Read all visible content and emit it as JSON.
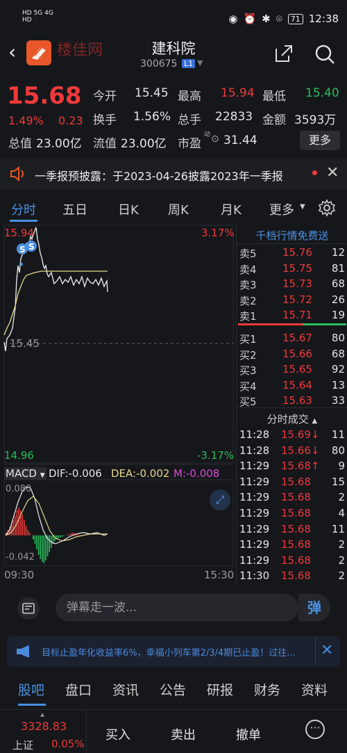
{
  "status_bar": {
    "left_top": "HD 5G 4G",
    "left_bottom": "HD",
    "battery": "71",
    "time": "12:38"
  },
  "header": {
    "watermark": "楼佳网",
    "name": "建科院",
    "code": "300675",
    "level": "L1"
  },
  "quote": {
    "price": "15.68",
    "change_pct": "1.49%",
    "change": "0.23",
    "open_label": "今开",
    "open": "15.45",
    "high_label": "最高",
    "high": "15.94",
    "low_label": "最低",
    "low": "15.40",
    "turnover_label": "换手",
    "turnover": "1.56%",
    "volume_label": "总手",
    "volume": "22833",
    "amount_label": "金额",
    "amount": "3593万",
    "total_cap_label": "总值",
    "total_cap": "23.00亿",
    "float_cap_label": "流值",
    "float_cap": "23.00亿",
    "pe_label": "市盈",
    "pe_sup": "动",
    "pe": "31.44",
    "more_label": "更多"
  },
  "news": {
    "text": "一季报预披露：于2023-04-26披露2023年一季报"
  },
  "chart_tabs": [
    "分时",
    "五日",
    "日K",
    "周K",
    "月K",
    "更多"
  ],
  "chart": {
    "y_top": "15.94",
    "y_bottom": "14.96",
    "pct_top": "3.17%",
    "pct_bottom": "-3.17%",
    "ref_price": "15.45",
    "macd_label": "MACD",
    "dif": "DIF:-0.006",
    "dea": "DEA:-0.002",
    "m": "M:-0.008",
    "macd_top": "0.080",
    "macd_bottom": "-0.042",
    "time_start": "09:30",
    "time_end": "15:30"
  },
  "orderbook": {
    "title": "千档行情免费送",
    "asks": [
      {
        "label": "卖5",
        "price": "15.76",
        "vol": "12"
      },
      {
        "label": "卖4",
        "price": "15.75",
        "vol": "81"
      },
      {
        "label": "卖3",
        "price": "15.73",
        "vol": "68"
      },
      {
        "label": "卖2",
        "price": "15.72",
        "vol": "26"
      },
      {
        "label": "卖1",
        "price": "15.71",
        "vol": "19"
      }
    ],
    "bids": [
      {
        "label": "买1",
        "price": "15.67",
        "vol": "80"
      },
      {
        "label": "买2",
        "price": "15.66",
        "vol": "68"
      },
      {
        "label": "买3",
        "price": "15.65",
        "vol": "92"
      },
      {
        "label": "买4",
        "price": "15.64",
        "vol": "13"
      },
      {
        "label": "买5",
        "price": "15.63",
        "vol": "33"
      }
    ],
    "ticks_title": "分时成交",
    "ticks": [
      {
        "time": "11:28",
        "price": "15.69↓",
        "vol": "11",
        "dir": "down"
      },
      {
        "time": "11:28",
        "price": "15.66↓",
        "vol": "80",
        "dir": "down"
      },
      {
        "time": "11:29",
        "price": "15.68↑",
        "vol": "9",
        "dir": "up"
      },
      {
        "time": "11:29",
        "price": "15.68",
        "vol": "15",
        "dir": "up"
      },
      {
        "time": "11:29",
        "price": "15.68",
        "vol": "2",
        "dir": "up"
      },
      {
        "time": "11:29",
        "price": "15.68",
        "vol": "4",
        "dir": "up"
      },
      {
        "time": "11:29",
        "price": "15.68",
        "vol": "11",
        "dir": "up"
      },
      {
        "time": "11:29",
        "price": "15.68",
        "vol": "2",
        "dir": "up"
      },
      {
        "time": "11:29",
        "price": "15.68",
        "vol": "2",
        "dir": "up"
      },
      {
        "time": "11:30",
        "price": "15.68",
        "vol": "2",
        "dir": "up"
      }
    ]
  },
  "comment": {
    "placeholder": "弹幕走一波...",
    "danmu": "弹"
  },
  "ad": {
    "text": "目标止盈年化收益率6%，幸福小列车第2/3/4期已止盈！过往..."
  },
  "bottom_tabs": [
    "股吧",
    "盘口",
    "资讯",
    "公告",
    "研报",
    "财务",
    "资料"
  ],
  "action_bar": {
    "index_value": "3328.83",
    "index_name": "上证",
    "index_pct": "0.05%",
    "buy": "买入",
    "sell": "卖出",
    "cancel": "撤单"
  },
  "colors": {
    "up": "#ee3a3a",
    "down": "#2bbd5d",
    "accent": "#4a90e2",
    "avg_line": "#e5d98b"
  }
}
